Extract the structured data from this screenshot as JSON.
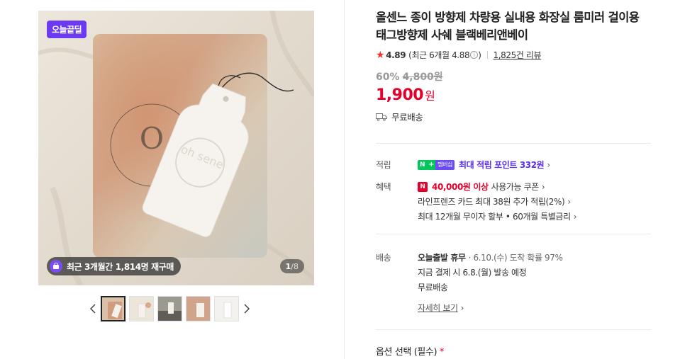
{
  "gallery": {
    "badge": "오늘끝딜",
    "repurchase_text": "최근 3개월간 1,814명 재구매",
    "counter_current": "1",
    "counter_total": "/8",
    "card_text": "oh sene"
  },
  "product": {
    "title": "올센느 종이 방향제 차량용 실내용 화장실 룸미러 걸이용 태그방향제 사쉐 블랙베리앤베이",
    "rating": "4.89",
    "recent_rating": "(최근 6개월 4.88",
    "info_icon": "i",
    "review_count": "1,825건 리뷰",
    "discount_rate": "60%",
    "original_price": "4,800원",
    "price": "1,900",
    "price_unit": "원",
    "shipping": "무료배송"
  },
  "points": {
    "label": "적립",
    "badge_n": "N",
    "badge_plus": "+",
    "badge_member": "멤버십",
    "text": "최대 적립 포인트 332원"
  },
  "benefits": {
    "label": "혜택",
    "badge": "N",
    "coupon_strong": "40,000원 이상",
    "coupon_text": "사용가능 쿠폰",
    "card": "라인프렌즈 카드 최대 38원 추가 적립(2%)",
    "installment": "최대 12개월 무이자 할부 • 60개월 특별금리"
  },
  "delivery": {
    "label": "배송",
    "status_strong": "오늘출발 휴무",
    "status_text": "· 6.10.(수) 도착 확률 97%",
    "dispatch": "지금 결제 시 6.8.(월) 발송 예정",
    "fee": "무료배송",
    "detail_link": "자세히 보기"
  },
  "options": {
    "label": "옵션 선택 (필수)",
    "required_mark": "*"
  },
  "colors": {
    "price_red": "#e4002b",
    "point_purple": "#5a2ff0",
    "badge_purple": "#6c3bf0",
    "npay_green": "#03c75a"
  }
}
